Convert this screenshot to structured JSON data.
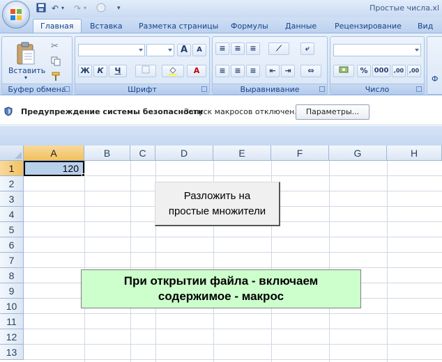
{
  "window": {
    "title": "Простые числа.xl"
  },
  "tabs": [
    {
      "label": "Главная",
      "active": true
    },
    {
      "label": "Вставка"
    },
    {
      "label": "Разметка страницы"
    },
    {
      "label": "Формулы"
    },
    {
      "label": "Данные"
    },
    {
      "label": "Рецензирование"
    },
    {
      "label": "Вид"
    }
  ],
  "ribbon": {
    "clipboard": {
      "paste_label": "Вставить",
      "group_label": "Буфер обмена"
    },
    "font": {
      "group_label": "Шрифт",
      "bold": "Ж",
      "italic": "К",
      "underline": "Ч",
      "grow": "A",
      "shrink": "A"
    },
    "alignment": {
      "group_label": "Выравнивание"
    },
    "number": {
      "group_label": "Число",
      "percent": "%",
      "thousands": "000",
      "inc_decimal": ",00",
      "dec_decimal": ",00"
    },
    "partial_label": "Ф"
  },
  "security": {
    "title": "Предупреждение системы безопасности",
    "message": "Запуск макросов отключен.",
    "options_button": "Параметры..."
  },
  "sheet": {
    "columns": [
      "A",
      "B",
      "C",
      "D",
      "E",
      "F",
      "G",
      "H"
    ],
    "rows": [
      "1",
      "2",
      "3",
      "4",
      "5",
      "6",
      "7",
      "8",
      "9",
      "10",
      "11",
      "12",
      "13"
    ],
    "selected_column": "A",
    "selected_row": "1",
    "cell_a1": "120",
    "macro_button": "Разложить на\nпростые множители",
    "note": "При открытии файла - включаем\nсодержимое - макрос"
  },
  "colors": {
    "note_bg": "#ccffcc",
    "selected_cell_bg": "#b8d0ea",
    "selected_header": "#f1c15f"
  }
}
